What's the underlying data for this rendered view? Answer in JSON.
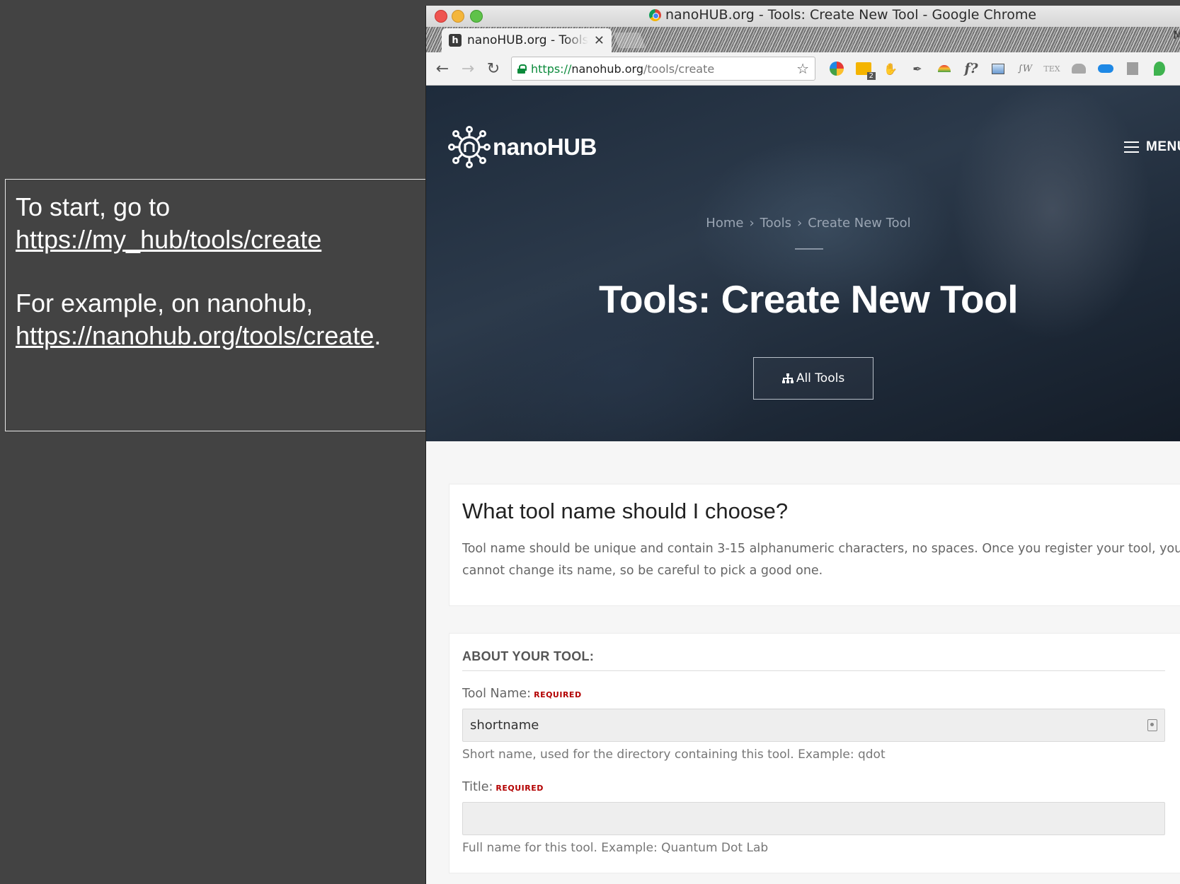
{
  "note": {
    "line1": "To start, go to",
    "link1": "https://my_hub/tools/create",
    "line2": "For example, on nanohub,",
    "link2": "https://nanohub.org/tools/create",
    "link2_suffix": "."
  },
  "window": {
    "title": "nanoHUB.org - Tools: Create New Tool - Google Chrome",
    "tab_title": "nanoHUB.org - Tools: Create New Tool",
    "tab_close": "✕",
    "tab_user": "Ma"
  },
  "toolbar": {
    "back": "←",
    "forward": "→",
    "reload": "↻",
    "url_scheme": "https://",
    "url_host": "nanohub.org",
    "url_path": "/tools/create",
    "star": "☆",
    "extensions": [
      "pinwheel-icon",
      "notes-icon",
      "evernote-icon",
      "feather-icon",
      "rainbow-icon",
      "formula-icon",
      "image-icon",
      "script-icon",
      "tex-icon",
      "drive-icon",
      "cloud-icon",
      "sheet-icon",
      "leaf-icon"
    ],
    "ext_note_badge": "2",
    "ext_formula": "f?",
    "ext_script": "∫W",
    "ext_tex": "TEX"
  },
  "hero": {
    "logo_text": "nanoHUB",
    "menu_label": "MENU",
    "breadcrumb": [
      "Home",
      "Tools",
      "Create New Tool"
    ],
    "breadcrumb_sep": "›",
    "title": "Tools: Create New Tool",
    "all_tools_label": "All Tools"
  },
  "choose_card": {
    "title": "What tool name should I choose?",
    "text": "Tool name should be unique and contain 3-15 alphanumeric characters, no spaces. Once you register your tool, you cannot change its name, so be careful to pick a good one."
  },
  "form": {
    "section_label": "ABOUT YOUR TOOL:",
    "required_label": "REQUIRED",
    "tool_name_label": "Tool Name:",
    "tool_name_value": "shortname",
    "tool_name_hint": "Short name, used for the directory containing this tool. Example: qdot",
    "title_label": "Title:",
    "title_value": "",
    "title_hint": "Full name for this tool. Example: Quantum Dot Lab"
  },
  "colors": {
    "slide_bg": "#434343",
    "hero_bg": "#1e2b3b",
    "required": "#b30000",
    "secure_green": "#0b8a3b"
  }
}
